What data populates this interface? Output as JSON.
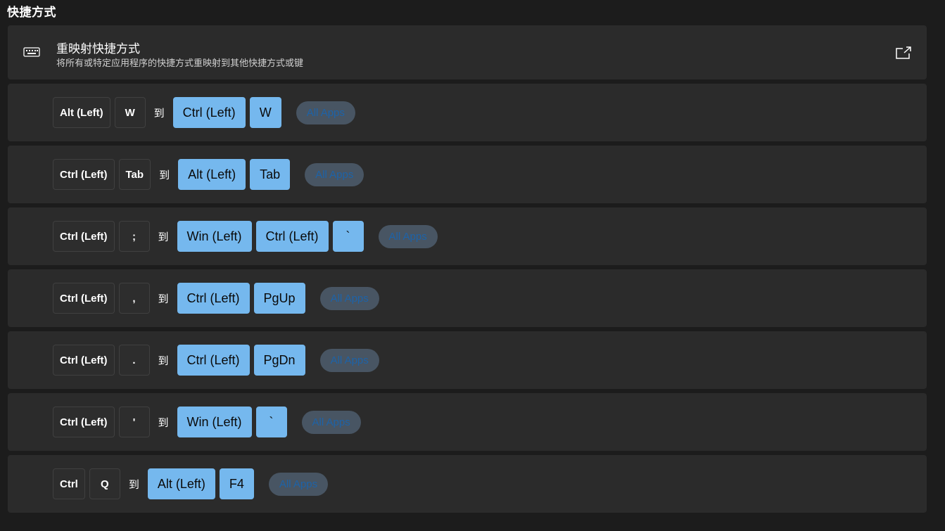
{
  "section": {
    "title": "快捷方式"
  },
  "header": {
    "icon": "keyboard-icon",
    "title": "重映射快捷方式",
    "description": "将所有或特定应用程序的快捷方式重映射到其他快捷方式或键",
    "open_icon": "open-external-icon"
  },
  "mappings": [
    {
      "from": [
        "Alt (Left)",
        "W"
      ],
      "connector": "到",
      "to": [
        "Ctrl (Left)",
        "W"
      ],
      "scope": "All Apps"
    },
    {
      "from": [
        "Ctrl (Left)",
        "Tab"
      ],
      "connector": "到",
      "to": [
        "Alt (Left)",
        "Tab"
      ],
      "scope": "All Apps"
    },
    {
      "from": [
        "Ctrl (Left)",
        ";"
      ],
      "connector": "到",
      "to": [
        "Win (Left)",
        "Ctrl (Left)",
        "`"
      ],
      "scope": "All Apps"
    },
    {
      "from": [
        "Ctrl (Left)",
        ","
      ],
      "connector": "到",
      "to": [
        "Ctrl (Left)",
        "PgUp"
      ],
      "scope": "All Apps"
    },
    {
      "from": [
        "Ctrl (Left)",
        "."
      ],
      "connector": "到",
      "to": [
        "Ctrl (Left)",
        "PgDn"
      ],
      "scope": "All Apps"
    },
    {
      "from": [
        "Ctrl (Left)",
        "'"
      ],
      "connector": "到",
      "to": [
        "Win (Left)",
        "`"
      ],
      "scope": "All Apps"
    },
    {
      "from": [
        "Ctrl",
        "Q"
      ],
      "connector": "到",
      "to": [
        "Alt (Left)",
        "F4"
      ],
      "scope": "All Apps"
    }
  ],
  "colors": {
    "background": "#1c1c1c",
    "card": "#2b2b2b",
    "target_key": "#75b8ee",
    "scope_pill": "#485563",
    "scope_text": "#1d63a8"
  }
}
